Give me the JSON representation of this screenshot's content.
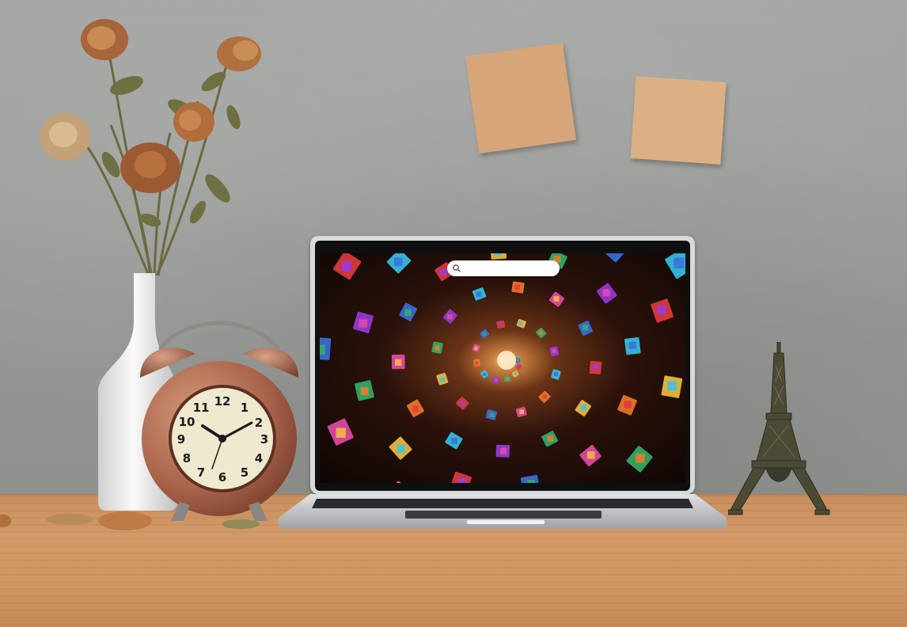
{
  "scene": {
    "description_tag": "desk-scene-with-laptop",
    "wall_color": "#9a9c99",
    "desk_color": "#d09563"
  },
  "laptop": {
    "screen": {
      "wallpaper": "stained-glass-spiral",
      "search": {
        "placeholder": "",
        "value": "",
        "icon": "search-icon"
      }
    }
  },
  "clock": {
    "numerals": [
      "12",
      "1",
      "2",
      "3",
      "4",
      "5",
      "6",
      "7",
      "8",
      "9",
      "10",
      "11"
    ]
  },
  "colors": {
    "sticky_note_1": "#d6a57a",
    "sticky_note_2": "#dcb084",
    "laptop_silver": "#d8d9db",
    "clock_copper": "#a8624a",
    "clock_face": "#efe9cf"
  }
}
